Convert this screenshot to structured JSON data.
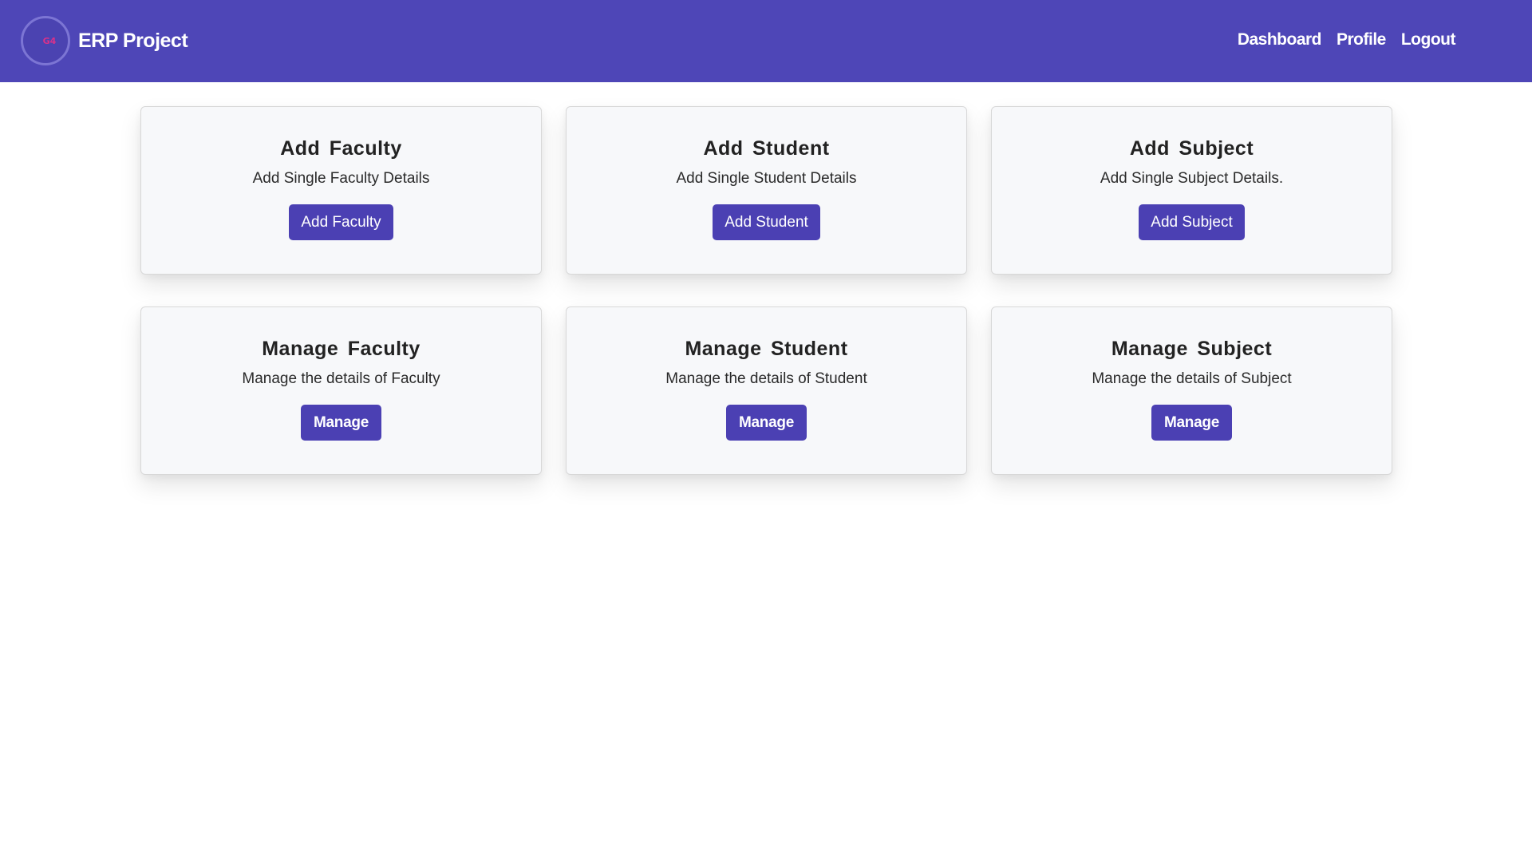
{
  "navbar": {
    "brand": "ERP Project",
    "logo_text": "G4",
    "links": [
      "Dashboard",
      "Profile",
      "Logout"
    ],
    "background": "#4e46b7"
  },
  "cards": [
    {
      "title": "Add Faculty",
      "description": "Add Single Faculty Details",
      "button": "Add Faculty"
    },
    {
      "title": "Add Student",
      "description": "Add Single Student Details",
      "button": "Add Student"
    },
    {
      "title": "Add Subject",
      "description": "Add Single Subject Details.",
      "button": "Add Subject"
    },
    {
      "title": "Manage Faculty",
      "description": "Manage the details of Faculty",
      "button": "Manage"
    },
    {
      "title": "Manage Student",
      "description": "Manage the details of Student",
      "button": "Manage"
    },
    {
      "title": "Manage Subject",
      "description": "Manage the details of Subject",
      "button": "Manage"
    }
  ],
  "colors": {
    "accent": "#4b40b3",
    "card_background": "#f7f8fa",
    "logo_mark": "#d9318a"
  }
}
